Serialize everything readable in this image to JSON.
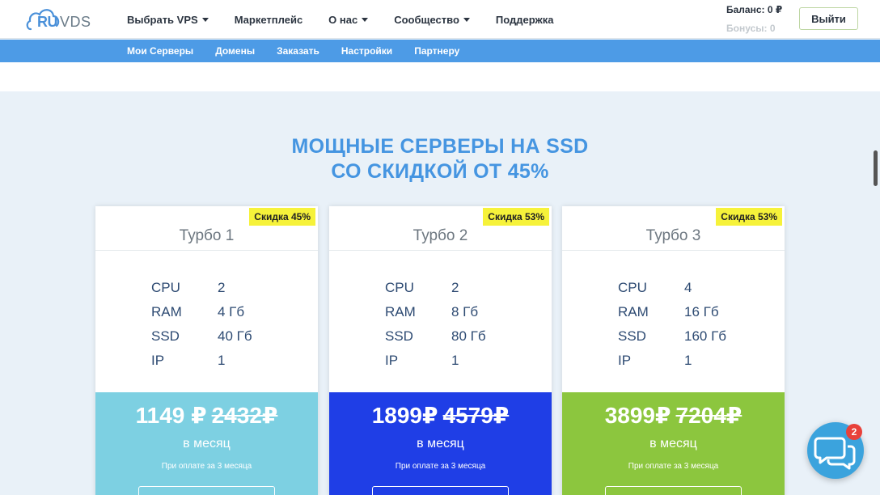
{
  "header": {
    "logo_ru": "RU",
    "logo_vds": "VDS",
    "nav": [
      {
        "label": "Выбрать VPS",
        "dropdown": true
      },
      {
        "label": "Маркетплейс",
        "dropdown": false
      },
      {
        "label": "О нас",
        "dropdown": true
      },
      {
        "label": "Сообщество",
        "dropdown": true
      },
      {
        "label": "Поддержка",
        "dropdown": false
      }
    ],
    "balance": "Баланс: 0 ₽",
    "bonus": "Бонусы: 0",
    "logout_label": "Выйти"
  },
  "subnav": [
    "Мои Серверы",
    "Домены",
    "Заказать",
    "Настройки",
    "Партнеру"
  ],
  "promo": {
    "line1": "МОЩНЫЕ СЕРВЕРЫ НА SSD",
    "line2": "СО СКИДКОЙ ОТ 45%"
  },
  "colors": {
    "accent": "#4595e1",
    "subnav_bg": "#4d9be6",
    "badge_bg": "#f6f23a",
    "chat_bg": "#3ba3dd",
    "chat_badge": "#e8413a"
  },
  "plans": [
    {
      "title": "Турбо 1",
      "badge": "Скидка 45%",
      "specs": [
        {
          "key": "CPU",
          "value": "2"
        },
        {
          "key": "RAM",
          "value": "4 Гб"
        },
        {
          "key": "SSD",
          "value": "40 Гб"
        },
        {
          "key": "IP",
          "value": "1"
        }
      ],
      "price": "1149 ₽",
      "old_price": "2432₽",
      "period": "в месяц",
      "note": "При оплате за 3 месяца",
      "color": "#7dd0e2"
    },
    {
      "title": "Турбо 2",
      "badge": "Скидка 53%",
      "specs": [
        {
          "key": "CPU",
          "value": "2"
        },
        {
          "key": "RAM",
          "value": "8 Гб"
        },
        {
          "key": "SSD",
          "value": "80 Гб"
        },
        {
          "key": "IP",
          "value": "1"
        }
      ],
      "price": "1899₽",
      "old_price": "4579₽",
      "period": "в месяц",
      "note": "При оплате за 3 месяца",
      "color": "#1f3ee6"
    },
    {
      "title": "Турбо 3",
      "badge": "Скидка 53%",
      "specs": [
        {
          "key": "CPU",
          "value": "4"
        },
        {
          "key": "RAM",
          "value": "16 Гб"
        },
        {
          "key": "SSD",
          "value": "160 Гб"
        },
        {
          "key": "IP",
          "value": "1"
        }
      ],
      "price": "3899₽",
      "old_price": "7204₽",
      "period": "в месяц",
      "note": "При оплате за 3 месяца",
      "color": "#8cc63e"
    }
  ],
  "chat": {
    "icon": "chat-bubbles-icon",
    "unread": "2"
  }
}
